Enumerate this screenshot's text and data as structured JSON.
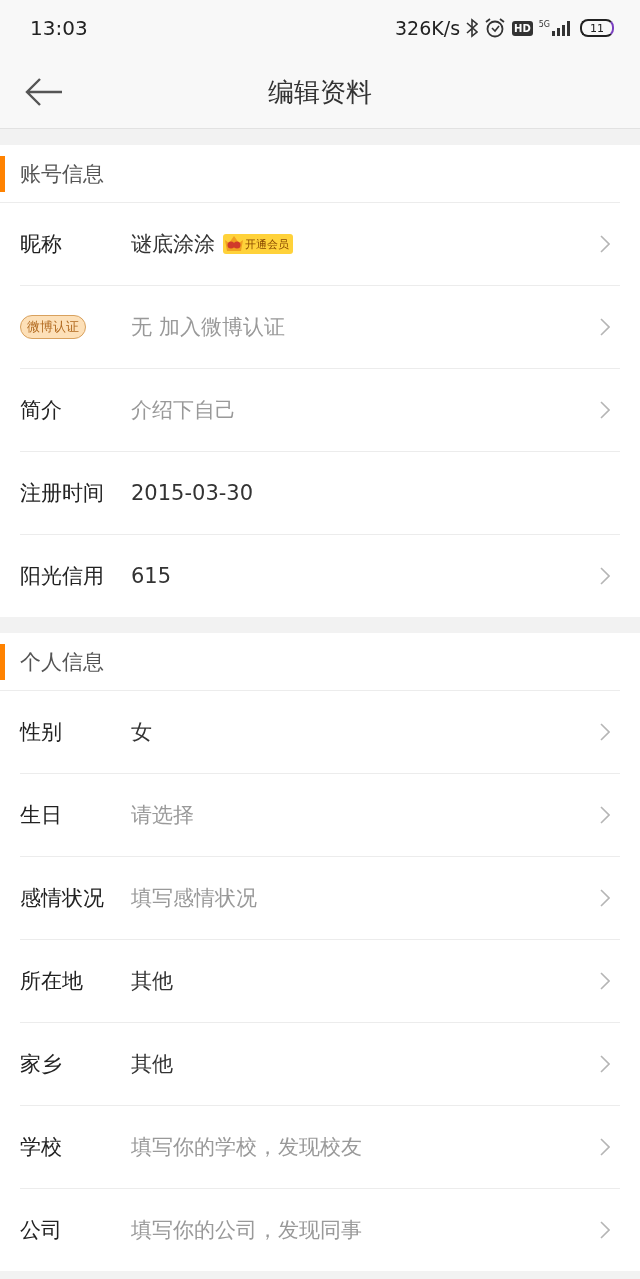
{
  "status_bar": {
    "time": "13:03",
    "speed": "326K/s",
    "hd": "HD",
    "network": "5G",
    "battery": "11"
  },
  "header": {
    "title": "编辑资料"
  },
  "sections": [
    {
      "title": "账号信息",
      "rows": [
        {
          "kind": "text",
          "label": "昵称",
          "value": "谜底涂涂",
          "badge": "开通会员",
          "chevron": true
        },
        {
          "kind": "tag",
          "label": "微博认证",
          "placeholder": "无 加入微博认证",
          "chevron": true
        },
        {
          "kind": "text",
          "label": "简介",
          "placeholder": "介绍下自己",
          "chevron": true
        },
        {
          "kind": "text",
          "label": "注册时间",
          "value": "2015-03-30",
          "chevron": false
        },
        {
          "kind": "text",
          "label": "阳光信用",
          "value": "615",
          "chevron": true
        }
      ]
    },
    {
      "title": "个人信息",
      "rows": [
        {
          "kind": "text",
          "label": "性别",
          "value": "女",
          "chevron": true
        },
        {
          "kind": "text",
          "label": "生日",
          "placeholder": "请选择",
          "chevron": true
        },
        {
          "kind": "text",
          "label": "感情状况",
          "placeholder": "填写感情状况",
          "chevron": true
        },
        {
          "kind": "text",
          "label": "所在地",
          "value": "其他",
          "chevron": true
        },
        {
          "kind": "text",
          "label": "家乡",
          "value": "其他",
          "chevron": true
        },
        {
          "kind": "text",
          "label": "学校",
          "placeholder": "填写你的学校，发现校友",
          "chevron": true
        },
        {
          "kind": "text",
          "label": "公司",
          "placeholder": "填写你的公司，发现同事",
          "chevron": true
        }
      ]
    }
  ]
}
